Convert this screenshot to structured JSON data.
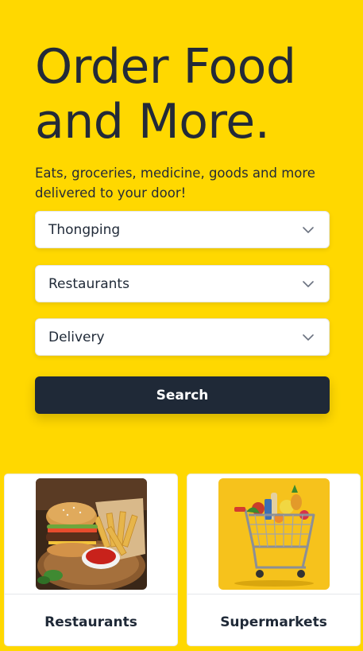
{
  "hero": {
    "title_line1": "Order Food",
    "title_line2": "and More.",
    "subtitle": "Eats, groceries, medicine, goods and more delivered to your door!"
  },
  "filters": {
    "location": {
      "value": "Thongping",
      "icon": "chevron-down-icon"
    },
    "category": {
      "value": "Restaurants",
      "icon": "chevron-down-icon"
    },
    "mode": {
      "value": "Delivery",
      "icon": "chevron-down-icon"
    }
  },
  "search": {
    "label": "Search"
  },
  "categories": [
    {
      "label": "Restaurants",
      "image": "burger-fries-image"
    },
    {
      "label": "Supermarkets",
      "image": "grocery-cart-image"
    }
  ],
  "colors": {
    "background": "#FFD800",
    "dark": "#1F2937",
    "white": "#FFFFFF"
  }
}
